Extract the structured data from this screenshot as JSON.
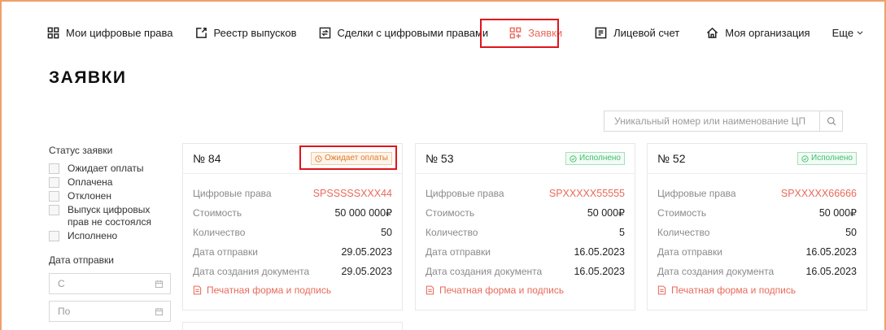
{
  "nav": {
    "items": [
      {
        "label": "Мои цифровые права",
        "icon": "grid-icon"
      },
      {
        "label": "Реестр выпусков",
        "icon": "edit-square-icon"
      },
      {
        "label": "Сделки с цифровыми правами",
        "icon": "swap-square-icon"
      },
      {
        "label": "Заявки",
        "icon": "apps-add-icon"
      },
      {
        "label": "Лицевой счет",
        "icon": "account-card-icon"
      },
      {
        "label": "Моя организация",
        "icon": "home-icon"
      },
      {
        "label": "Еще",
        "icon": "chevron-down-icon"
      }
    ],
    "active_index": 3
  },
  "page": {
    "title": "ЗАЯВКИ"
  },
  "search": {
    "placeholder": "Уникальный номер или наименование ЦП"
  },
  "filters": {
    "status_heading": "Статус заявки",
    "statuses": [
      "Ожидает оплаты",
      "Оплачена",
      "Отклонен",
      "Выпуск цифровых прав не состоялся",
      "Исполнено"
    ],
    "date_heading": "Дата отправки",
    "date_from_placeholder": "С",
    "date_to_placeholder": "По"
  },
  "field_labels": {
    "rights": "Цифровые права",
    "cost": "Стоимость",
    "quantity": "Количество",
    "sent_date": "Дата отправки",
    "doc_date": "Дата создания документа"
  },
  "print_link_label": "Печатная форма и подпись",
  "colors": {
    "accent": "#e86a5a",
    "highlight_border": "#e0141c",
    "status_done": "#3dbf6a",
    "status_pending": "#e07b2a",
    "window_border": "#f0a06a"
  },
  "cards": [
    {
      "number": "№ 84",
      "status": "Ожидает оплаты",
      "status_kind": "pending",
      "rights": "SPSSSSSXXX44",
      "cost": "50 000 000₽",
      "quantity": "50",
      "sent_date": "29.05.2023",
      "doc_date": "29.05.2023"
    },
    {
      "number": "№ 53",
      "status": "Исполнено",
      "status_kind": "done",
      "rights": "SPXXXXX55555",
      "cost": "50 000₽",
      "quantity": "5",
      "sent_date": "16.05.2023",
      "doc_date": "16.05.2023"
    },
    {
      "number": "№ 52",
      "status": "Исполнено",
      "status_kind": "done",
      "rights": "SPXXXXX66666",
      "cost": "50 000₽",
      "quantity": "50",
      "sent_date": "16.05.2023",
      "doc_date": "16.05.2023"
    }
  ]
}
